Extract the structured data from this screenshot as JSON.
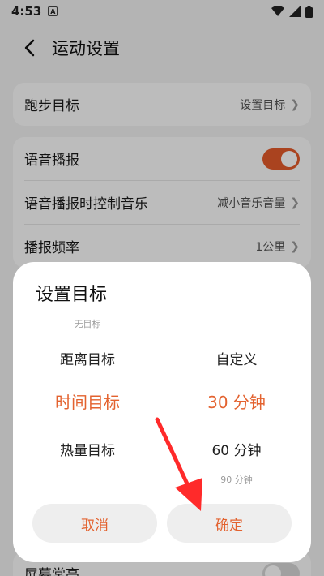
{
  "status": {
    "time": "4:53",
    "a_label": "A"
  },
  "appbar": {
    "title": "运动设置"
  },
  "settings": {
    "goal": {
      "label": "跑步目标",
      "value": "设置目标"
    },
    "voice": {
      "label": "语音播报"
    },
    "voice_music": {
      "label": "语音播报时控制音乐",
      "value": "减小音乐音量"
    },
    "frequency": {
      "label": "播报频率",
      "value": "1公里"
    },
    "screen": {
      "label": "屏幕常亮"
    }
  },
  "dialog": {
    "title": "设置目标",
    "left_options": [
      "无目标",
      "距离目标",
      "时间目标",
      "热量目标"
    ],
    "left_selected": "时间目标",
    "right_options": [
      "自定义",
      "30 分钟",
      "60 分钟",
      "90 分钟"
    ],
    "right_selected": "30 分钟",
    "cancel": "取消",
    "confirm": "确定"
  },
  "colors": {
    "accent": "#e3622f",
    "toggle_on": "#e35a2a",
    "arrow": "#ff2a2a"
  }
}
